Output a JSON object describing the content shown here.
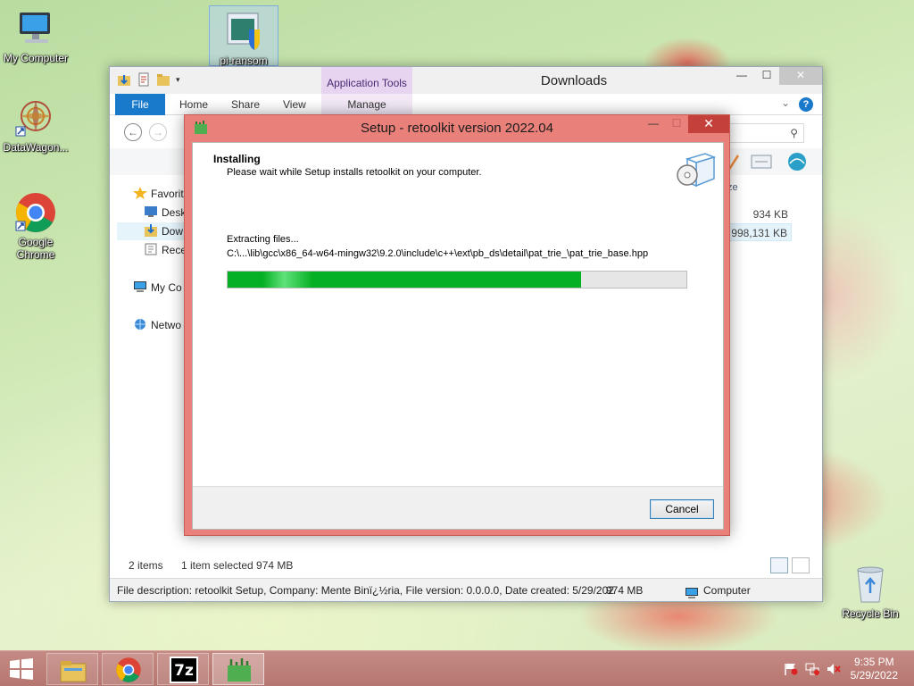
{
  "desktop": {
    "icons": [
      {
        "label": "My Computer"
      },
      {
        "label": "DataWagon..."
      },
      {
        "label": "Google Chrome"
      },
      {
        "label": "pi-ransom"
      },
      {
        "label": "Recycle Bin"
      }
    ]
  },
  "explorer": {
    "title": "Downloads",
    "context_tab": "Application Tools",
    "tabs": [
      "File",
      "Home",
      "Share",
      "View",
      "Manage"
    ],
    "nav_items": [
      "Favorit",
      "Desk",
      "Dow",
      "Rece",
      "My Co",
      "Netwo"
    ],
    "column_size": "ze",
    "file_sizes": [
      "934 KB",
      "998,131 KB"
    ],
    "status": {
      "items": "2 items",
      "selected": "1 item selected  974 MB"
    },
    "details": {
      "description": "File description: retoolkit Setup, Company: Mente Binï¿½ria, File version: 0.0.0.0, Date created: 5/29/202",
      "size": "974 MB",
      "location": "Computer"
    }
  },
  "setup": {
    "title": "Setup - retoolkit version 2022.04",
    "heading": "Installing",
    "subheading": "Please wait while Setup installs retoolkit on your computer.",
    "status_label": "Extracting files...",
    "current_file": "C:\\...\\lib\\gcc\\x86_64-w64-mingw32\\9.2.0\\include\\c++\\ext\\pb_ds\\detail\\pat_trie_\\pat_trie_base.hpp",
    "progress_percent": 77,
    "cancel_label": "Cancel"
  },
  "taskbar": {
    "apps": [
      "file-explorer",
      "google-chrome",
      "7-zip",
      "retoolkit-setup"
    ],
    "seven_zip_label": "7z",
    "time": "9:35 PM",
    "date": "5/29/2022"
  },
  "colors": {
    "accent": "#1979ca",
    "setup_frame": "#e9807a",
    "progress": "#06b025",
    "taskbar": "#b5766f"
  }
}
